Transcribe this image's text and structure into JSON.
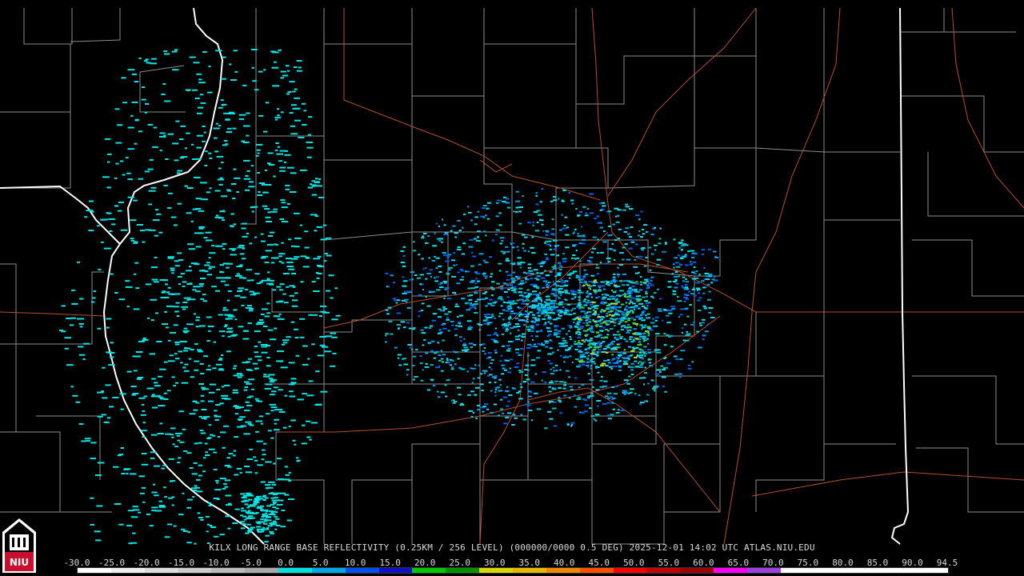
{
  "product_title": "KILX LONG RANGE BASE REFLECTIVITY (0.25KM / 256 LEVEL) (000000/0000 0.5 DEG) 2025-12-01 14:02 UTC  ATLAS.NIU.EDU",
  "logo_text": "NIU",
  "scale_labels": [
    "-30.0",
    "-25.0",
    "-20.0",
    "-15.0",
    "-10.0",
    "-5.0",
    "0.0",
    "5.0",
    "10.0",
    "15.0",
    "20.0",
    "25.0",
    "30.0",
    "35.0",
    "40.0",
    "45.0",
    "50.0",
    "55.0",
    "60.0",
    "65.0",
    "70.0",
    "75.0",
    "80.0",
    "85.0",
    "90.0",
    "94.5"
  ],
  "scale_colors": [
    "#ffffff",
    "#eeeeee",
    "#dddddd",
    "#cccccc",
    "#bbbbbb",
    "#aaaaaa",
    "#00e0e0",
    "#00a8e8",
    "#0050f0",
    "#1010c8",
    "#00c800",
    "#009000",
    "#d8d800",
    "#e8b800",
    "#f08800",
    "#ff5000",
    "#ff0000",
    "#c80000",
    "#a00000",
    "#ff00ff",
    "#a040e0",
    "#ffffff",
    "#ffffff",
    "#ffffff",
    "#ffffff",
    "#ffffff"
  ],
  "colors": {
    "background": "#000000",
    "county_border": "#8c8c8c",
    "state_border": "#ffffff",
    "highway": "#b4502a",
    "echo_primary": "#00e6e6"
  }
}
